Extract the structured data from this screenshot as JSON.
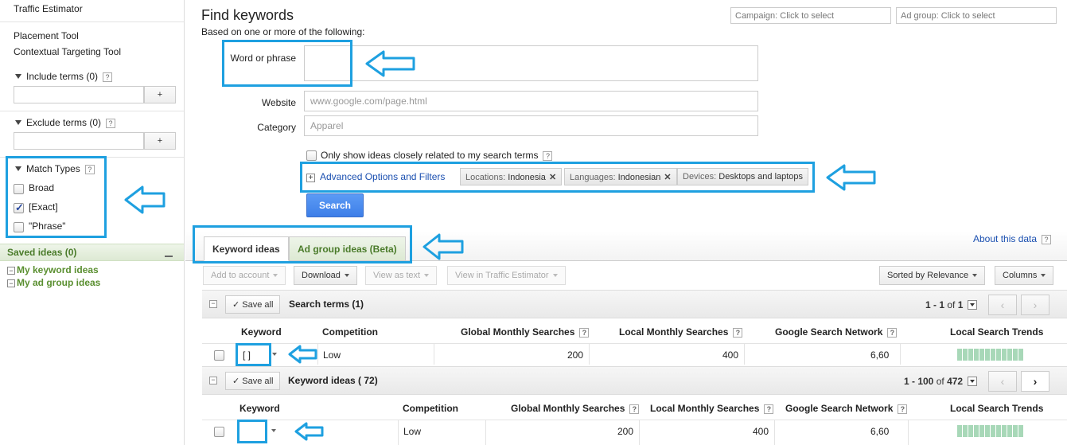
{
  "sidebar": {
    "traffic_estimator": "Traffic Estimator",
    "placement_tool": "Placement Tool",
    "contextual_targeting": "Contextual Targeting Tool",
    "include_terms": "Include terms (0)",
    "exclude_terms": "Exclude terms (0)",
    "plus_label": "+",
    "help_label": "?",
    "match_types": {
      "title": "Match Types",
      "items": [
        {
          "label": "Broad",
          "checked": false
        },
        {
          "label": "[Exact]",
          "checked": true
        },
        {
          "label": "\"Phrase\"",
          "checked": false
        }
      ]
    },
    "saved_ideas": {
      "title": "Saved ideas (0)",
      "items": [
        "My keyword ideas",
        "My ad group ideas"
      ]
    }
  },
  "header": {
    "title": "Find keywords",
    "subtitle": "Based on one or more of the following:",
    "campaign_placeholder": "Campaign: Click to select",
    "adgroup_placeholder": "Ad group: Click to select"
  },
  "form": {
    "word_label": "Word or phrase",
    "website_label": "Website",
    "website_placeholder": "www.google.com/page.html",
    "category_label": "Category",
    "category_placeholder": "Apparel",
    "only_show_label": "Only show ideas closely related to my search terms",
    "advanced_label": "Advanced Options and Filters",
    "chips": [
      {
        "key": "Locations:",
        "value": "Indonesia"
      },
      {
        "key": "Languages:",
        "value": "Indonesian"
      },
      {
        "key": "Devices:",
        "value": "Desktops and laptops"
      }
    ],
    "search_button": "Search"
  },
  "tabs": {
    "keyword_ideas": "Keyword ideas",
    "adgroup_ideas": "Ad group ideas (Beta)",
    "about_link": "About this data"
  },
  "toolbar": {
    "add_to_account": "Add to account",
    "download": "Download",
    "view_as_text": "View as text",
    "view_in_te": "View in Traffic Estimator",
    "sorted_by": "Sorted by Relevance",
    "columns": "Columns"
  },
  "search_terms": {
    "save_all": "Save all",
    "title": "Search terms (1)",
    "pager_range": "1 - 1",
    "pager_of": "of",
    "pager_total": "1"
  },
  "keyword_ideas": {
    "save_all": "Save all",
    "title": "Keyword ideas (  72)",
    "pager_range": "1 - 100",
    "pager_of": "of",
    "pager_total": "472"
  },
  "columns": {
    "keyword": "Keyword",
    "competition": "Competition",
    "global": "Global Monthly Searches",
    "local": "Local Monthly Searches",
    "gsn": "Google Search Network",
    "trends": "Local Search Trends"
  },
  "search_term_row": {
    "keyword": "[        ]",
    "competition": "Low",
    "global": "200",
    "local": "400",
    "gsn": "6,60"
  },
  "keyword_idea_row": {
    "keyword": "",
    "competition": "Low",
    "global": "200",
    "local": "400",
    "gsn": "6,60"
  },
  "icons": {
    "check": "✓",
    "close": "✕",
    "prev": "‹",
    "next": "›",
    "minus": "−",
    "expand": "+",
    "arrow": "⇦"
  },
  "colors": {
    "highlight": "#1ea0e0",
    "link": "#1a4fb0",
    "saved_green": "#4a7b2a",
    "search_button": "#4d8df0"
  }
}
